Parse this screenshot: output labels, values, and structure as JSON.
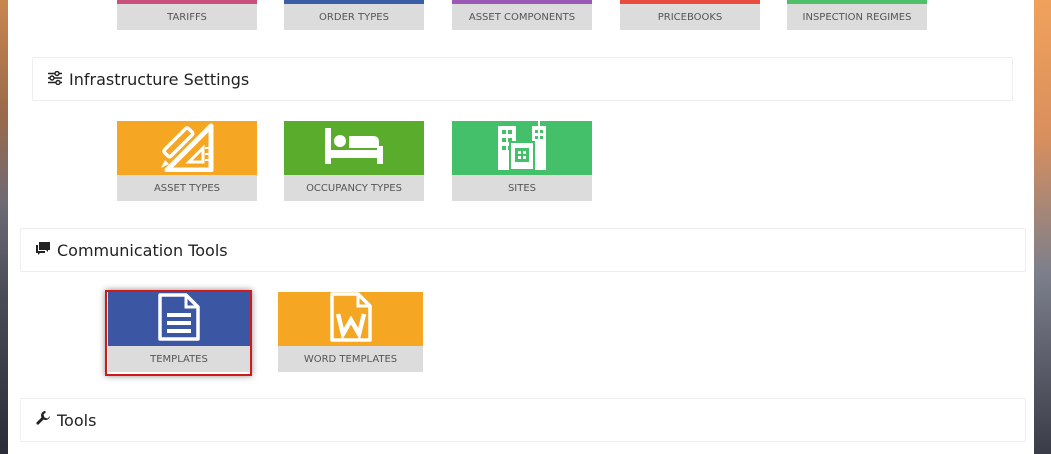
{
  "top_row": [
    {
      "label": "TARIFFS",
      "color": "#c94f7c"
    },
    {
      "label": "ORDER TYPES",
      "color": "#3b5ea6"
    },
    {
      "label": "ASSET COMPONENTS",
      "color": "#9b59b6"
    },
    {
      "label": "PRICEBOOKS",
      "color": "#e74c3c"
    },
    {
      "label": "INSPECTION REGIMES",
      "color": "#4fbf6a"
    }
  ],
  "infrastructure": {
    "title": "Infrastructure Settings",
    "icon": "sliders-icon",
    "tiles": [
      {
        "label": "ASSET TYPES",
        "color": "#f5a623",
        "icon": "drafting-tools-icon"
      },
      {
        "label": "OCCUPANCY TYPES",
        "color": "#5aad2c",
        "icon": "bed-icon"
      },
      {
        "label": "SITES",
        "color": "#45c06a",
        "icon": "buildings-icon"
      }
    ]
  },
  "communication": {
    "title": "Communication Tools",
    "icon": "comments-icon",
    "tiles": [
      {
        "label": "TEMPLATES",
        "color": "#3b57a3",
        "icon": "document-icon",
        "selected": true
      },
      {
        "label": "WORD TEMPLATES",
        "color": "#f5a623",
        "icon": "word-document-icon"
      }
    ]
  },
  "tools": {
    "title": "Tools",
    "icon": "wrench-icon"
  }
}
